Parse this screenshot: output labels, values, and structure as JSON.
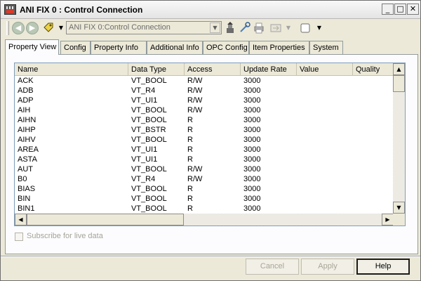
{
  "window": {
    "title": "ANI FIX 0 : Control Connection",
    "controls": {
      "minimize": "_",
      "maximize": "□",
      "close": "✕"
    }
  },
  "toolbar": {
    "path_value": "ANI FIX 0:Control Connection",
    "icons": [
      "back-icon",
      "forward-icon",
      "tag-icon",
      "dropdown-icon",
      "connect-icon",
      "link-icon",
      "print-icon",
      "format-icon",
      "view-icon"
    ]
  },
  "tabs": [
    {
      "label": "Property View",
      "active": true
    },
    {
      "label": "Config"
    },
    {
      "label": "Property Info"
    },
    {
      "label": "Additional Info"
    },
    {
      "label": "OPC Config"
    },
    {
      "label": "Item Properties"
    },
    {
      "label": "System"
    }
  ],
  "grid": {
    "columns": [
      "Name",
      "Data Type",
      "Access",
      "Update Rate",
      "Value",
      "Quality"
    ],
    "rows": [
      [
        "ACK",
        "VT_BOOL",
        "R/W",
        "3000",
        "",
        ""
      ],
      [
        "ADB",
        "VT_R4",
        "R/W",
        "3000",
        "",
        ""
      ],
      [
        "ADP",
        "VT_UI1",
        "R/W",
        "3000",
        "",
        ""
      ],
      [
        "AIH",
        "VT_BOOL",
        "R/W",
        "3000",
        "",
        ""
      ],
      [
        "AIHN",
        "VT_BOOL",
        "R",
        "3000",
        "",
        ""
      ],
      [
        "AIHP",
        "VT_BSTR",
        "R",
        "3000",
        "",
        ""
      ],
      [
        "AIHV",
        "VT_BOOL",
        "R",
        "3000",
        "",
        ""
      ],
      [
        "AREA",
        "VT_UI1",
        "R",
        "3000",
        "",
        ""
      ],
      [
        "ASTA",
        "VT_UI1",
        "R",
        "3000",
        "",
        ""
      ],
      [
        "AUT",
        "VT_BOOL",
        "R/W",
        "3000",
        "",
        ""
      ],
      [
        "B0",
        "VT_R4",
        "R/W",
        "3000",
        "",
        ""
      ],
      [
        "BIAS",
        "VT_BOOL",
        "R",
        "3000",
        "",
        ""
      ],
      [
        "BIN",
        "VT_BOOL",
        "R",
        "3000",
        "",
        ""
      ],
      [
        "BIN1",
        "VT_BOOL",
        "R",
        "3000",
        "",
        ""
      ]
    ]
  },
  "subscribe_label": "Subscribe for live data",
  "buttons": {
    "cancel": "Cancel",
    "apply": "Apply",
    "help": "Help"
  }
}
